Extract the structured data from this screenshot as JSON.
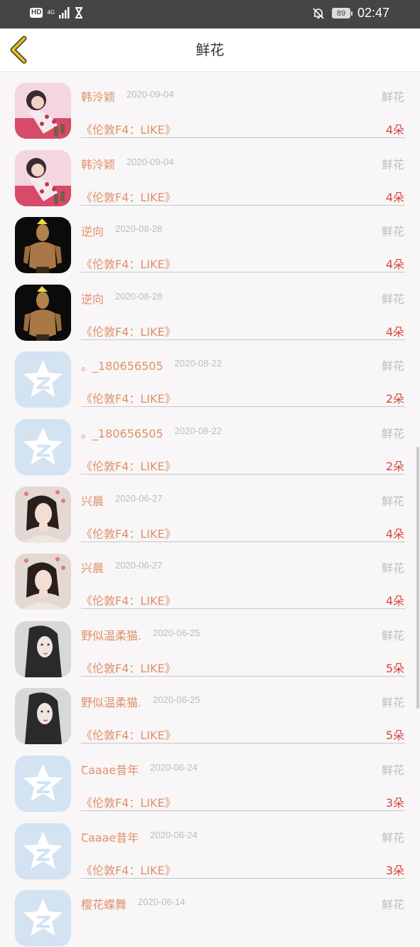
{
  "status_bar": {
    "hd": "HD",
    "network": "4G",
    "battery": "89",
    "time": "02:47"
  },
  "header": {
    "title": "鲜花"
  },
  "items": [
    {
      "name": "韩泠颖",
      "date": "2020-09-04",
      "gift": "鲜花",
      "song": "《伦敦F4：LIKE》",
      "count": "4朵",
      "avatar": "anime-girl"
    },
    {
      "name": "韩泠颖",
      "date": "2020-09-04",
      "gift": "鲜花",
      "song": "《伦敦F4：LIKE》",
      "count": "4朵",
      "avatar": "anime-girl"
    },
    {
      "name": "逆向",
      "date": "2020-08-28",
      "gift": "鲜花",
      "song": "《伦敦F4：LIKE》",
      "count": "4朵",
      "avatar": "dark-figure"
    },
    {
      "name": "逆向",
      "date": "2020-08-28",
      "gift": "鲜花",
      "song": "《伦敦F4：LIKE》",
      "count": "4朵",
      "avatar": "dark-figure"
    },
    {
      "name": "。_180656505",
      "date": "2020-08-22",
      "gift": "鲜花",
      "song": "《伦敦F4：LIKE》",
      "count": "2朵",
      "avatar": "qq-default"
    },
    {
      "name": "。_180656505",
      "date": "2020-08-22",
      "gift": "鲜花",
      "song": "《伦敦F4：LIKE》",
      "count": "2朵",
      "avatar": "qq-default"
    },
    {
      "name": "兴晨",
      "date": "2020-06-27",
      "gift": "鲜花",
      "song": "《伦敦F4：LIKE》",
      "count": "4朵",
      "avatar": "girl-photo"
    },
    {
      "name": "兴晨",
      "date": "2020-06-27",
      "gift": "鲜花",
      "song": "《伦敦F4：LIKE》",
      "count": "4朵",
      "avatar": "girl-photo"
    },
    {
      "name": "野似温柔猫.",
      "date": "2020-06-25",
      "gift": "鲜花",
      "song": "《伦敦F4：LIKE》",
      "count": "5朵",
      "avatar": "bw-girl"
    },
    {
      "name": "野似温柔猫.",
      "date": "2020-06-25",
      "gift": "鲜花",
      "song": "《伦敦F4：LIKE》",
      "count": "5朵",
      "avatar": "bw-girl"
    },
    {
      "name": "Ꞇaaae昔年",
      "date": "2020-06-24",
      "gift": "鲜花",
      "song": "《伦敦F4：LIKE》",
      "count": "3朵",
      "avatar": "qq-default"
    },
    {
      "name": "Ꞇaaae昔年",
      "date": "2020-06-24",
      "gift": "鲜花",
      "song": "《伦敦F4：LIKE》",
      "count": "3朵",
      "avatar": "qq-default"
    },
    {
      "name": "樱花蝶舞",
      "date": "2020-06-14",
      "gift": "鲜花",
      "song": "",
      "count": "",
      "avatar": "qq-default"
    }
  ]
}
